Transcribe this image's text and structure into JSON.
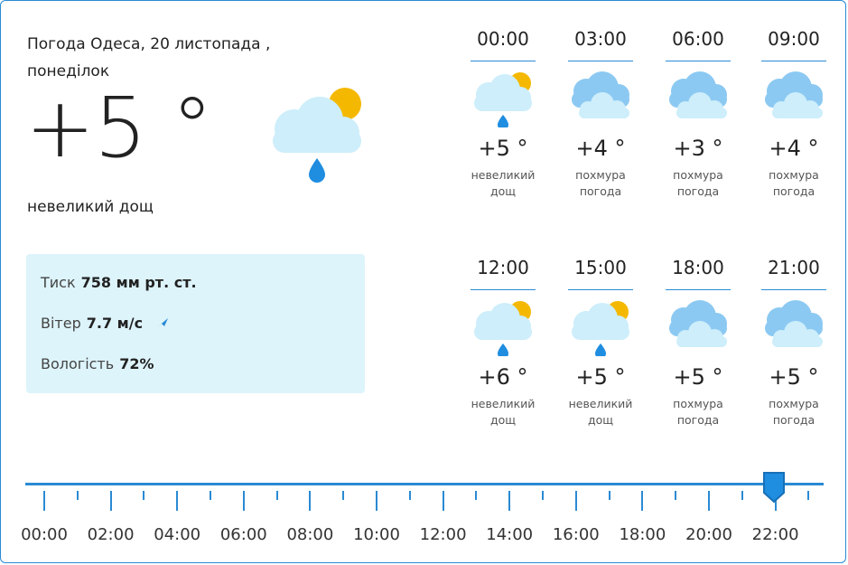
{
  "header": {
    "title": "Погода Одеса, 20 листопада , понеділок"
  },
  "current": {
    "temp": "+5 °",
    "condition": "невеликий дощ",
    "icon": "cloud-sun-rain-icon"
  },
  "details": {
    "pressure_label": "Тиск",
    "pressure_value": "758 мм рт. ст.",
    "wind_label": "Вітер",
    "wind_value": "7.7 м/с",
    "humidity_label": "Вологість",
    "humidity_value": "72%"
  },
  "hourly": [
    {
      "time": "00:00",
      "temp": "+5 °",
      "desc1": "невеликий",
      "desc2": "дощ",
      "icon": "cloud-sun-rain-icon"
    },
    {
      "time": "03:00",
      "temp": "+4 °",
      "desc1": "похмура",
      "desc2": "погода",
      "icon": "overcast-icon"
    },
    {
      "time": "06:00",
      "temp": "+3 °",
      "desc1": "похмура",
      "desc2": "погода",
      "icon": "overcast-icon"
    },
    {
      "time": "09:00",
      "temp": "+4 °",
      "desc1": "похмура",
      "desc2": "погода",
      "icon": "overcast-icon"
    },
    {
      "time": "12:00",
      "temp": "+6 °",
      "desc1": "невеликий",
      "desc2": "дощ",
      "icon": "cloud-sun-rain-icon"
    },
    {
      "time": "15:00",
      "temp": "+5 °",
      "desc1": "невеликий",
      "desc2": "дощ",
      "icon": "cloud-sun-rain-icon"
    },
    {
      "time": "18:00",
      "temp": "+5 °",
      "desc1": "похмура",
      "desc2": "погода",
      "icon": "overcast-icon"
    },
    {
      "time": "21:00",
      "temp": "+5 °",
      "desc1": "похмура",
      "desc2": "погода",
      "icon": "overcast-icon"
    }
  ],
  "timeline": {
    "labels": [
      "00:00",
      "02:00",
      "04:00",
      "06:00",
      "08:00",
      "10:00",
      "12:00",
      "14:00",
      "16:00",
      "18:00",
      "20:00",
      "22:00"
    ],
    "selected": "22:00"
  },
  "colors": {
    "accent": "#2a8ad4",
    "panel_bg": "#ddf4fb",
    "cloud": "#cdeefa",
    "cloud_dark": "#8cc9f2",
    "sun": "#f5b800",
    "rain": "#1f8de0"
  }
}
